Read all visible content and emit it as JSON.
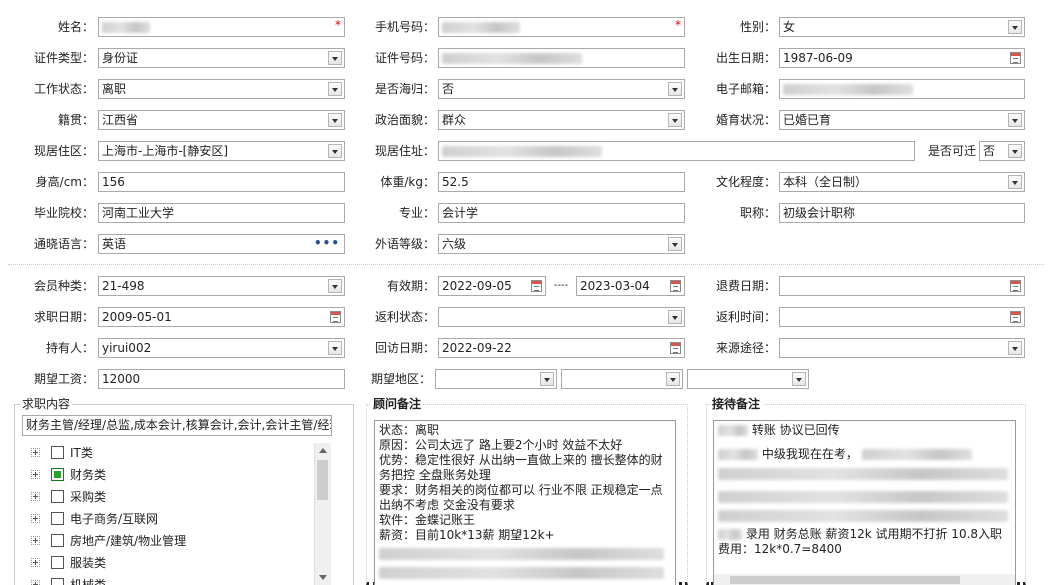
{
  "colors": {
    "required": "#ee0000",
    "checked": "#2aa12a",
    "link_dots": "#2a4f9a"
  },
  "personal": {
    "name": {
      "label": "姓名："
    },
    "phone": {
      "label": "手机号码："
    },
    "gender": {
      "label": "性别：",
      "value": "女"
    },
    "id_type": {
      "label": "证件类型：",
      "value": "身份证"
    },
    "id_number": {
      "label": "证件号码："
    },
    "birth_date": {
      "label": "出生日期：",
      "value": "1987-06-09"
    },
    "work_status": {
      "label": "工作状态：",
      "value": "离职"
    },
    "overseas_return": {
      "label": "是否海归：",
      "value": "否"
    },
    "email": {
      "label": "电子邮箱："
    },
    "native_place": {
      "label": "籍贯：",
      "value": "江西省"
    },
    "political_status": {
      "label": "政治面貌：",
      "value": "群众"
    },
    "marital_status": {
      "label": "婚育状况：",
      "value": "已婚已育"
    },
    "current_area": {
      "label": "现居住区：",
      "value": "上海市-上海市-[静安区]"
    },
    "current_address": {
      "label": "现居住址："
    },
    "relocatable": {
      "label": "是否可迁",
      "value": "否"
    },
    "height": {
      "label": "身高/cm：",
      "value": "156"
    },
    "weight": {
      "label": "体重/kg：",
      "value": "52.5"
    },
    "education": {
      "label": "文化程度：",
      "value": "本科（全日制）"
    },
    "school": {
      "label": "毕业院校：",
      "value": "河南工业大学"
    },
    "major": {
      "label": "专业：",
      "value": "会计学"
    },
    "title": {
      "label": "职称：",
      "value": "初级会计职称"
    },
    "language": {
      "label": "通晓语言：",
      "value": "英语",
      "more": "•••"
    },
    "language_level": {
      "label": "外语等级：",
      "value": "六级"
    }
  },
  "membership": {
    "member_type": {
      "label": "会员种类：",
      "value": "21-498"
    },
    "valid_period": {
      "label": "有效期：",
      "start": "2022-09-05",
      "sep": "----",
      "end": "2023-03-04"
    },
    "refund_date": {
      "label": "退费日期："
    },
    "job_date": {
      "label": "求职日期：",
      "value": "2009-05-01"
    },
    "rebate_status": {
      "label": "返利状态："
    },
    "rebate_time": {
      "label": "返利时间："
    },
    "holder": {
      "label": "持有人：",
      "value": "yirui002"
    },
    "revisit_date": {
      "label": "回访日期：",
      "value": "2022-09-22"
    },
    "source": {
      "label": "来源途径："
    },
    "expected_salary": {
      "label": "期望工资：",
      "value": "12000"
    },
    "expected_region": {
      "label": "期望地区："
    }
  },
  "job_content": {
    "title": "求职内容",
    "summary": "财务主管/经理/总监,成本会计,核算会计,会计,会计主管/经理",
    "categories": [
      {
        "label": "IT类",
        "checked": false
      },
      {
        "label": "财务类",
        "checked": true
      },
      {
        "label": "采购类",
        "checked": false
      },
      {
        "label": "电子商务/互联网",
        "checked": false
      },
      {
        "label": "房地产/建筑/物业管理",
        "checked": false
      },
      {
        "label": "服装类",
        "checked": false
      },
      {
        "label": "机械类",
        "checked": false
      }
    ]
  },
  "consultant_notes": {
    "title": "顾问备注",
    "lines": [
      "状态：离职",
      "原因：公司太远了  路上要2个小时  效益不太好",
      "优势：稳定性很好 从出纳一直做上来的 擅长整体的财务把控 全盘账务处理",
      "要求：财务相关的岗位都可以 行业不限 正规稳定一点 出纳不考虑 交金没有要求",
      "软件：金蝶记账王",
      "薪资：目前10k*13薪  期望12k+"
    ]
  },
  "reception_notes": {
    "title": "接待备注",
    "lines": [
      "转账 协议已回传",
      "中级我现在在考，",
      "录用 财务总账 薪资12k 试用期不打折 10.8入职",
      "费用：12k*0.7=8400"
    ]
  }
}
